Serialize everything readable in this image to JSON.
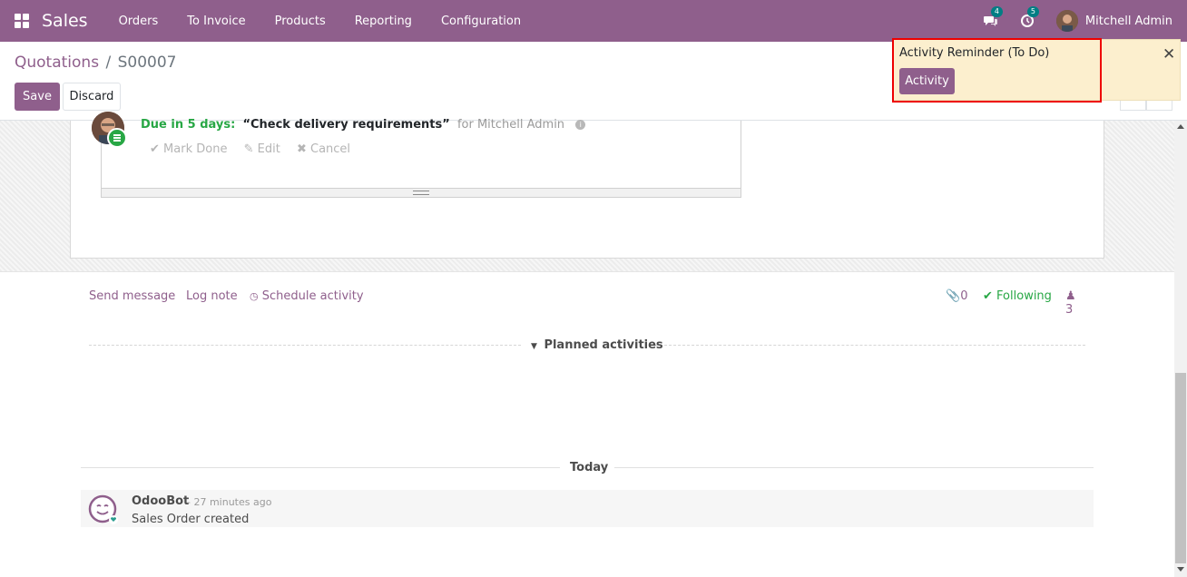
{
  "navbar": {
    "app_name": "Sales",
    "menu": [
      "Orders",
      "To Invoice",
      "Products",
      "Reporting",
      "Configuration"
    ],
    "messages_count": "4",
    "activities_count": "5",
    "user_name": "Mitchell Admin"
  },
  "control_panel": {
    "breadcrumb_parent": "Quotations",
    "breadcrumb_separator": "/",
    "breadcrumb_current": "S00007",
    "save_label": "Save",
    "discard_label": "Discard"
  },
  "notification": {
    "title": "Activity Reminder (To Do)",
    "button_label": "Activity",
    "close_glyph": "✕"
  },
  "chatter": {
    "send_message": "Send message",
    "log_note": "Log note",
    "schedule_activity": "Schedule activity",
    "attachments_count": "0",
    "following_label": "Following",
    "followers_count": "3",
    "planned_title": "Planned activities",
    "activity": {
      "due": "Due in 5 days:",
      "summary": "“Check delivery requirements”",
      "assignee": "for Mitchell Admin",
      "mark_done": "Mark Done",
      "edit": "Edit",
      "cancel": "Cancel"
    },
    "today_label": "Today",
    "message": {
      "author": "OdooBot",
      "time": "- 27 minutes ago",
      "body": "Sales Order created"
    }
  },
  "colors": {
    "brand": "#8f5f8c",
    "success": "#28a745",
    "badge": "#017e84",
    "notification_bg": "#fcefce",
    "highlight": "#ee0000"
  }
}
